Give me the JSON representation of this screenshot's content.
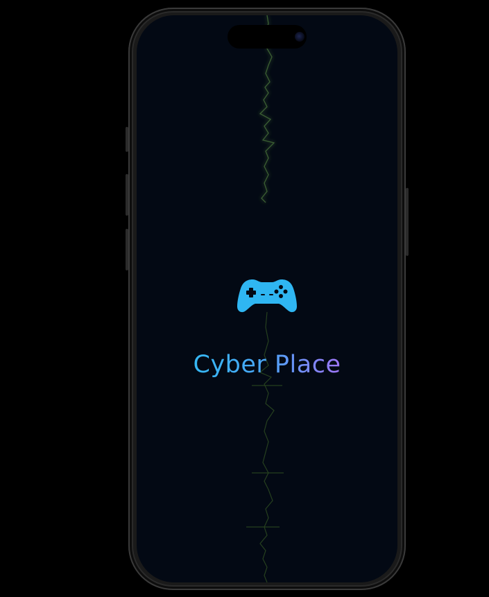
{
  "app": {
    "title": "Cyber Place",
    "logo_icon": "gamepad-icon"
  },
  "colors": {
    "background": "#000000",
    "screen_background": "#030914",
    "gamepad": "#2fb6f2",
    "title_gradient": [
      "#25c6f2",
      "#4aa5f7",
      "#c65cf3"
    ],
    "wave_line": "#2e4a2a"
  }
}
